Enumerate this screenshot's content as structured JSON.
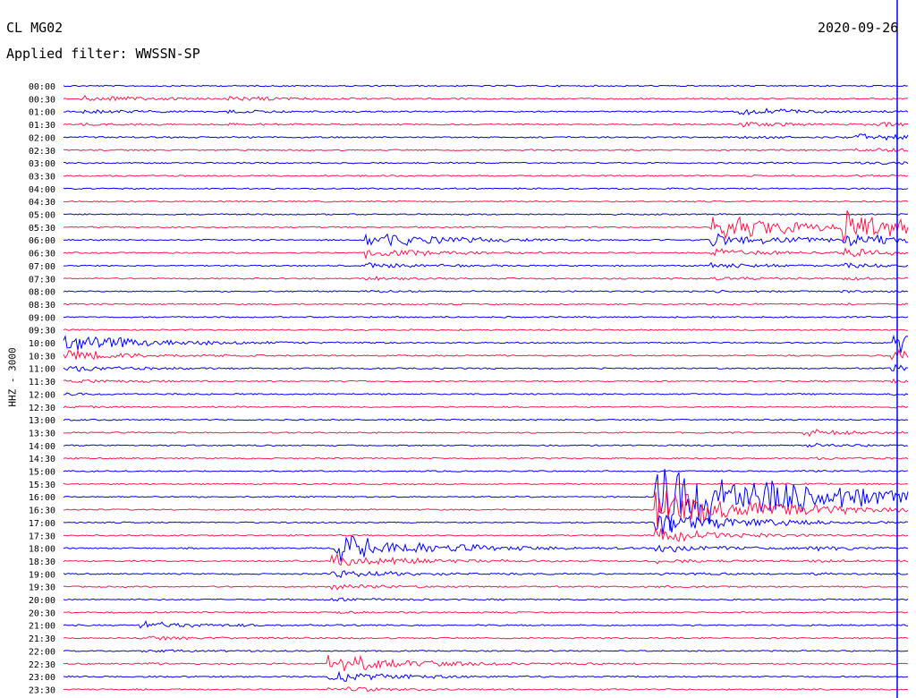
{
  "header": {
    "station": "CL MG02",
    "date": "2020-09-26",
    "filter": "Applied filter: WWSSN-SP"
  },
  "chart_data": {
    "type": "line",
    "title": "",
    "ylabel": "HHZ - 3000",
    "x_unit": "minutes past row start",
    "xlim": [
      0,
      30
    ],
    "rows": [
      "00:00",
      "00:30",
      "01:00",
      "01:30",
      "02:00",
      "02:30",
      "03:00",
      "03:30",
      "04:00",
      "04:30",
      "05:00",
      "05:30",
      "06:00",
      "06:30",
      "07:00",
      "07:30",
      "08:00",
      "08:30",
      "09:00",
      "09:30",
      "10:00",
      "10:30",
      "11:00",
      "11:30",
      "12:00",
      "12:30",
      "13:00",
      "13:30",
      "14:00",
      "14:30",
      "15:00",
      "15:30",
      "16:00",
      "16:30",
      "17:00",
      "17:30",
      "18:00",
      "18:30",
      "19:00",
      "19:30",
      "20:00",
      "20:30",
      "21:00",
      "21:30",
      "22:00",
      "22:30",
      "23:00",
      "23:30"
    ],
    "colors": [
      "#0000ff",
      "#ff1a4d"
    ],
    "current_time_marker": "12:00",
    "events": [
      {
        "row": "00:30",
        "minute": 0.8,
        "amplitude": 0.6
      },
      {
        "row": "00:30",
        "minute": 6.0,
        "amplitude": 0.4
      },
      {
        "row": "01:00",
        "minute": 24.2,
        "amplitude": 0.7
      },
      {
        "row": "01:30",
        "minute": 29.0,
        "amplitude": 0.3
      },
      {
        "row": "02:00",
        "minute": 28.3,
        "amplitude": 0.5
      },
      {
        "row": "06:00",
        "minute": 10.9,
        "amplitude": 1.5
      },
      {
        "row": "05:30",
        "minute": 23.2,
        "amplitude": 2.5
      },
      {
        "row": "05:30",
        "minute": 27.8,
        "amplitude": 2.2
      },
      {
        "row": "10:00",
        "minute": 0.2,
        "amplitude": 1.8
      },
      {
        "row": "10:00",
        "minute": 29.6,
        "amplitude": 2.0
      },
      {
        "row": "13:30",
        "minute": 26.5,
        "amplitude": 0.5
      },
      {
        "row": "18:00",
        "minute": 9.7,
        "amplitude": 2.5
      },
      {
        "row": "18:00",
        "minute": 26.6,
        "amplitude": 0.4
      },
      {
        "row": "21:00",
        "minute": 2.9,
        "amplitude": 0.6
      },
      {
        "row": "22:30",
        "minute": 9.6,
        "amplitude": 1.6
      },
      {
        "row": "16:00",
        "minute": 21.2,
        "amplitude": 7.0
      }
    ]
  }
}
